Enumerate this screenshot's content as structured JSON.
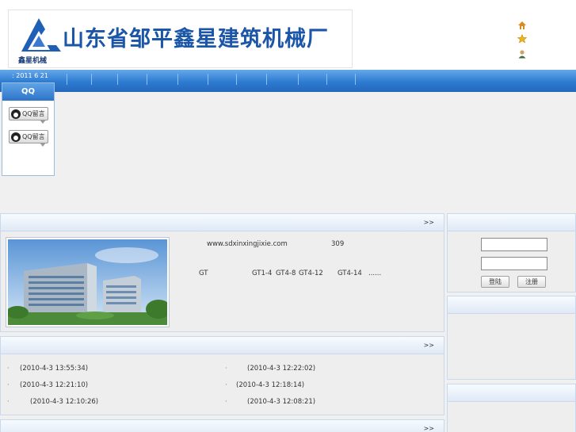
{
  "header": {
    "company_name": "山东省邹平鑫星建筑机械厂",
    "logo_text": "鑫星机械",
    "icons": [
      "home-icon",
      "star-icon",
      "user-icon"
    ]
  },
  "nav": {
    "date": ": 2011 6 21"
  },
  "qq": {
    "title": "QQ",
    "buttons": [
      "QQ留言",
      "QQ留言"
    ]
  },
  "intro": {
    "more": ">>",
    "website": "www.sdxinxingjixie.com",
    "number": "309",
    "product_prefix": "GT",
    "products": [
      "GT1-4",
      "GT4-8",
      "GT4-12",
      "GT4-14",
      "......"
    ]
  },
  "news": {
    "more": ">>",
    "items": [
      {
        "date": "(2010-4-3 13:55:34)"
      },
      {
        "date": "(2010-4-3 12:22:02)"
      },
      {
        "date": "(2010-4-3 12:21:10)"
      },
      {
        "date": "(2010-4-3 12:18:14)"
      },
      {
        "date": "(2010-4-3 12:10:26)"
      },
      {
        "date": "(2010-4-3 12:08:21)"
      }
    ]
  },
  "bottom": {
    "more": ">>"
  },
  "login": {
    "login_label": "登陆",
    "register_label": "注册"
  },
  "colors": {
    "nav_blue": "#2d7bd0",
    "brand_blue": "#1c56a8",
    "panel_bg": "#eeeeee"
  }
}
